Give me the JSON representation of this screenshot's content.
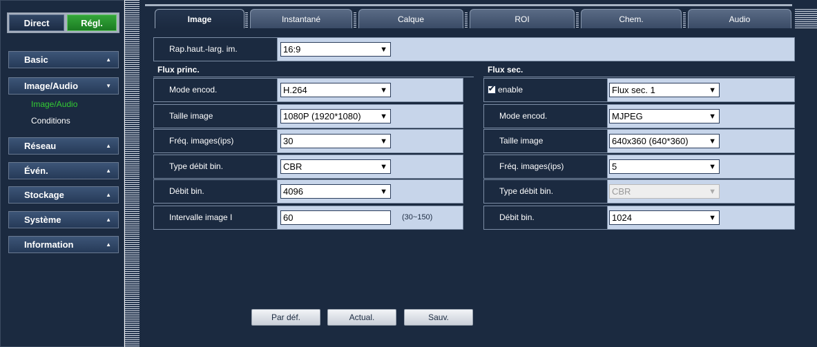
{
  "top_buttons": {
    "direct": "Direct",
    "regl": "Régl."
  },
  "sidebar": {
    "menus": [
      {
        "label": "Basic",
        "arrow": "▲"
      },
      {
        "label": "Image/Audio",
        "arrow": "▼"
      },
      {
        "label": "Réseau",
        "arrow": "▲"
      },
      {
        "label": "Évén.",
        "arrow": "▲"
      },
      {
        "label": "Stockage",
        "arrow": "▲"
      },
      {
        "label": "Système",
        "arrow": "▲"
      },
      {
        "label": "Information",
        "arrow": "▲"
      }
    ],
    "submenu": [
      {
        "label": "Image/Audio",
        "active": true
      },
      {
        "label": "Conditions",
        "active": false
      }
    ]
  },
  "tabs": [
    "Image",
    "Instantané",
    "Calque",
    "ROI",
    "Chem.",
    "Audio"
  ],
  "active_tab": "Image",
  "aspect": {
    "label": "Rap.haut.-larg. im.",
    "value": "16:9"
  },
  "main_stream": {
    "header": "Flux princ.",
    "rows": [
      {
        "label": "Mode encod.",
        "value": "H.264"
      },
      {
        "label": "Taille image",
        "value": "1080P (1920*1080)"
      },
      {
        "label": "Fréq. images(ips)",
        "value": "30"
      },
      {
        "label": "Type débit bin.",
        "value": "CBR"
      },
      {
        "label": "Débit bin.",
        "value": "4096"
      },
      {
        "label": "Intervalle image I",
        "value": "60",
        "hint": "(30~150)"
      }
    ]
  },
  "sub_stream": {
    "header": "Flux sec.",
    "enable_label": "enable",
    "enable_checked": true,
    "stream_select": "Flux sec. 1",
    "rows": [
      {
        "label": "Mode encod.",
        "value": "MJPEG"
      },
      {
        "label": "Taille image",
        "value": "640x360 (640*360)"
      },
      {
        "label": "Fréq. images(ips)",
        "value": "5"
      },
      {
        "label": "Type débit bin.",
        "value": "CBR",
        "disabled": true
      },
      {
        "label": "Débit bin.",
        "value": "1024"
      }
    ]
  },
  "buttons": {
    "default": "Par déf.",
    "refresh": "Actual.",
    "save": "Sauv."
  },
  "icons": {
    "dropdown": "chevron-down-icon",
    "check": "check-icon",
    "expand": "triangle-up-icon"
  },
  "colors": {
    "panel_bg": "#1b2a40",
    "value_bg": "#c7d5ea",
    "active_green": "#2a8f2f",
    "sub_active": "#33cc33"
  }
}
